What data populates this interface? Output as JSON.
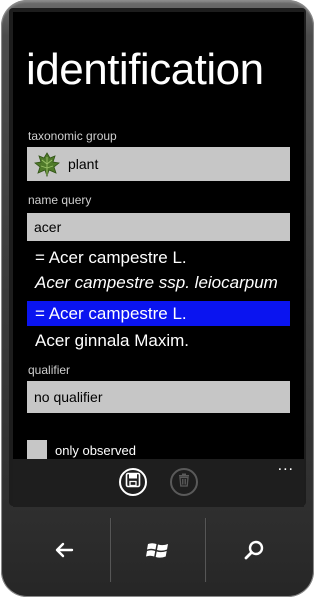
{
  "page": {
    "title": "identification"
  },
  "taxonomic_group": {
    "label": "taxonomic group",
    "value": "plant",
    "icon": "leaf-icon"
  },
  "name_query": {
    "label": "name query",
    "value": "acer",
    "results": [
      {
        "text": "= Acer campestre L.",
        "style": "normal",
        "selected": false
      },
      {
        "text": "Acer campestre ssp. leiocarpum",
        "style": "italic",
        "selected": false
      },
      {
        "text": "= Acer campestre L.",
        "style": "normal",
        "selected": true
      },
      {
        "text": "Acer ginnala Maxim.",
        "style": "normal",
        "selected": false
      }
    ]
  },
  "qualifier": {
    "label": "qualifier",
    "value": "no qualifier"
  },
  "only_observed": {
    "label": "only observed",
    "checked": false
  },
  "app_bar": {
    "buttons": [
      {
        "name": "save",
        "icon": "save-icon",
        "enabled": true
      },
      {
        "name": "delete",
        "icon": "trash-icon",
        "enabled": false
      }
    ],
    "more": "..."
  },
  "hardware_keys": [
    {
      "name": "back",
      "icon": "back-arrow-icon"
    },
    {
      "name": "start",
      "icon": "windows-logo-icon"
    },
    {
      "name": "search",
      "icon": "search-icon"
    }
  ],
  "colors": {
    "accent": "#0a14f0",
    "field_background": "#c6c6c6",
    "screen_background": "#000000",
    "app_bar": "#1e1e1e"
  }
}
